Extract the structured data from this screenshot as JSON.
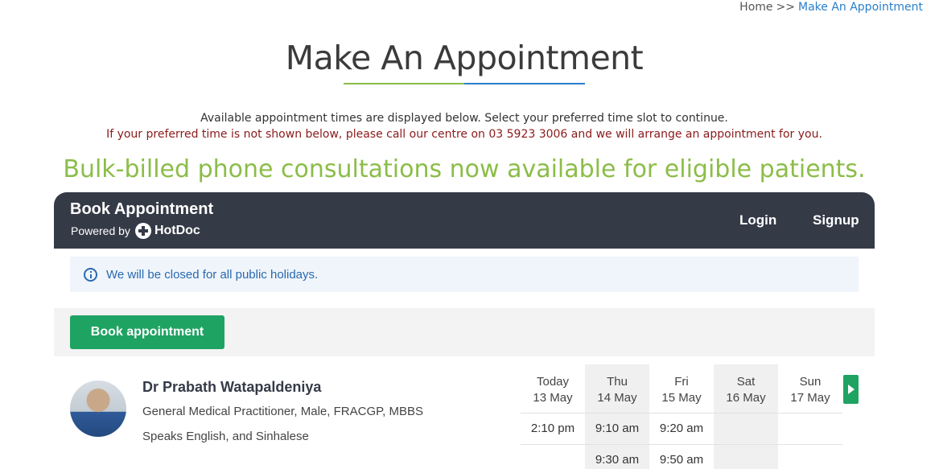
{
  "breadcrumb": {
    "home": "Home",
    "separator": ">>",
    "current": "Make An Appointment"
  },
  "page": {
    "title": "Make An Appointment",
    "intro": "Available appointment times are displayed below. Select your preferred time slot to continue.",
    "warning": "If your preferred time is not shown below, please call our centre on 03 5923 3006 and we will arrange an appointment for you.",
    "promo": "Bulk-billed phone consultations now available for eligible patients."
  },
  "widget": {
    "title": "Book Appointment",
    "powered_by": "Powered by",
    "brand": "HotDoc",
    "login": "Login",
    "signup": "Signup",
    "notice": "We will be closed for all public holidays.",
    "book_button": "Book appointment"
  },
  "doctor": {
    "name": "Dr Prabath Watapaldeniya",
    "description": "General Medical Practitioner, Male, FRACGP, MBBS",
    "languages": "Speaks English, and Sinhalese"
  },
  "schedule": {
    "days": [
      {
        "day": "Today",
        "date": "13 May",
        "shaded": false,
        "slots": [
          "2:10 pm"
        ]
      },
      {
        "day": "Thu",
        "date": "14 May",
        "shaded": true,
        "slots": [
          "9:10 am",
          "9:30 am"
        ]
      },
      {
        "day": "Fri",
        "date": "15 May",
        "shaded": false,
        "slots": [
          "9:20 am",
          "9:50 am"
        ]
      },
      {
        "day": "Sat",
        "date": "16 May",
        "shaded": true,
        "slots": []
      },
      {
        "day": "Sun",
        "date": "17 May",
        "shaded": false,
        "slots": []
      }
    ]
  },
  "colors": {
    "accent_green": "#8bbd48",
    "accent_blue": "#2a7fc9",
    "header_bg": "#353a47",
    "button_green": "#1fa363",
    "warning_red": "#8b1a1a"
  }
}
